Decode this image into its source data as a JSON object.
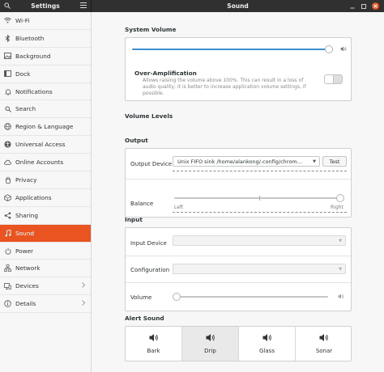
{
  "header": {
    "sidebar_title": "Settings",
    "page_title": "Sound"
  },
  "icons": {
    "search": "search-icon",
    "menu": "hamburger-menu-icon",
    "minimize": "minimize-icon",
    "maximize": "maximize-icon",
    "close": "close-icon",
    "speaker": "speaker-icon"
  },
  "colors": {
    "accent": "#e95420",
    "slider_fill": "#3e8fd0",
    "headerbar": "#303030"
  },
  "sidebar": {
    "items": [
      {
        "label": "Wi-Fi",
        "icon": "wifi-icon"
      },
      {
        "label": "Bluetooth",
        "icon": "bluetooth-icon"
      },
      {
        "label": "Background",
        "icon": "background-icon"
      },
      {
        "label": "Dock",
        "icon": "dock-icon"
      },
      {
        "label": "Notifications",
        "icon": "bell-icon"
      },
      {
        "label": "Search",
        "icon": "search-icon"
      },
      {
        "label": "Region & Language",
        "icon": "globe-icon"
      },
      {
        "label": "Universal Access",
        "icon": "accessibility-icon"
      },
      {
        "label": "Online Accounts",
        "icon": "cloud-icon"
      },
      {
        "label": "Privacy",
        "icon": "hand-icon"
      },
      {
        "label": "Applications",
        "icon": "apps-icon"
      },
      {
        "label": "Sharing",
        "icon": "share-icon"
      },
      {
        "label": "Sound",
        "icon": "music-note-icon",
        "active": true
      },
      {
        "label": "Power",
        "icon": "power-icon"
      },
      {
        "label": "Network",
        "icon": "network-icon"
      },
      {
        "label": "Devices",
        "icon": "devices-icon",
        "chevron": true
      },
      {
        "label": "Details",
        "icon": "info-icon",
        "chevron": true
      }
    ]
  },
  "system_volume": {
    "title": "System Volume",
    "level": 1.0,
    "over_amplification": {
      "title": "Over-Amplification",
      "description": "Allows raising the volume above 100%. This can result in a loss of audio quality; it is better to increase application volume settings, if possible.",
      "enabled": false
    }
  },
  "volume_levels": {
    "title": "Volume Levels"
  },
  "output": {
    "title": "Output",
    "device_label": "Output Device",
    "device_value": "Unix FIFO sink /home/alankong/.config/chrom…",
    "test_label": "Test",
    "balance_label": "Balance",
    "balance_left": "Left",
    "balance_right": "Right",
    "balance_value": 1.0
  },
  "input": {
    "title": "Input",
    "device_label": "Input Device",
    "device_value": "",
    "configuration_label": "Configuration",
    "configuration_value": "",
    "volume_label": "Volume",
    "volume_level": 0.0
  },
  "alert_sound": {
    "title": "Alert Sound",
    "options": [
      {
        "label": "Bark",
        "selected": false
      },
      {
        "label": "Drip",
        "selected": true
      },
      {
        "label": "Glass",
        "selected": false
      },
      {
        "label": "Sonar",
        "selected": false
      }
    ]
  }
}
